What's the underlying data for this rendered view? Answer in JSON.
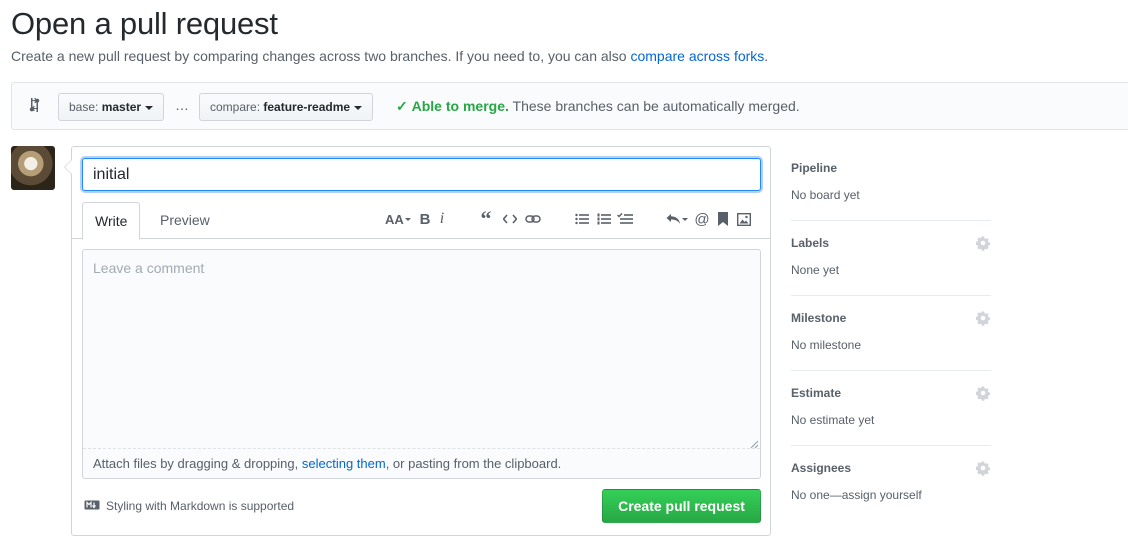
{
  "header": {
    "title": "Open a pull request",
    "description": "Create a new pull request by comparing changes across two branches. If you need to, you can also",
    "description_link": "compare across forks",
    "description_end": "."
  },
  "range": {
    "base_prefix": "base:",
    "base_branch": "master",
    "separator": "…",
    "compare_prefix": "compare:",
    "compare_branch": "feature-readme",
    "merge_ok_label": "Able to merge.",
    "merge_message": "These branches can be automatically merged."
  },
  "composer": {
    "title_value": "initial",
    "tabs": [
      {
        "label": "Write"
      },
      {
        "label": "Preview"
      }
    ],
    "toolbar_icons": [
      "text-size-icon",
      "bold-icon",
      "italic-icon",
      "quote-icon",
      "code-icon",
      "link-icon",
      "bulleted-list-icon",
      "numbered-list-icon",
      "task-list-icon",
      "reply-icon",
      "mention-icon",
      "bookmark-icon",
      "image-icon"
    ],
    "comment_placeholder": "Leave a comment",
    "attach_text_before": "Attach files by dragging & dropping,",
    "attach_link": "selecting them",
    "attach_text_after": ", or pasting from the clipboard.",
    "markdown_note": "Styling with Markdown is supported",
    "submit_label": "Create pull request"
  },
  "sidebar": {
    "sections": [
      {
        "heading": "Pipeline",
        "value": "No board yet",
        "has_gear": false
      },
      {
        "heading": "Labels",
        "value": "None yet",
        "has_gear": true
      },
      {
        "heading": "Milestone",
        "value": "No milestone",
        "has_gear": true
      },
      {
        "heading": "Estimate",
        "value": "No estimate yet",
        "has_gear": true
      },
      {
        "heading": "Assignees",
        "value": "No one—assign yourself",
        "has_gear": true
      }
    ]
  },
  "colors": {
    "link": "#0366d6",
    "success": "#28a745",
    "button_green": "#2ea44f",
    "focus_border": "#2188ff",
    "muted_text": "#586069"
  }
}
